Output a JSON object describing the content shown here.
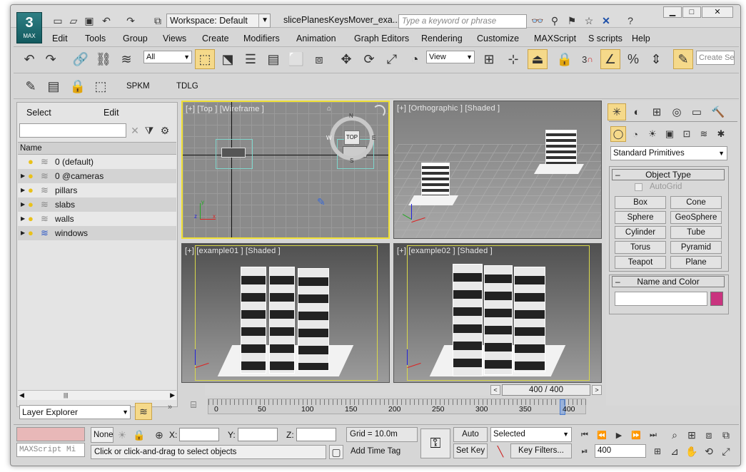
{
  "title_bar": {
    "workspace": "Workspace: Default",
    "file": "slicePlanesKeysMover_exa...",
    "search_placeholder": "Type a keyword or phrase",
    "app_logo": "MAX"
  },
  "menu": [
    "Edit",
    "Tools",
    "Group",
    "Views",
    "Create",
    "Modifiers",
    "Animation",
    "Graph Editors",
    "Rendering",
    "Customize",
    "MAXScript",
    "S scripts",
    "Help"
  ],
  "toolbar": {
    "selection_filter": "All",
    "ref_coord": "View",
    "create_sel": "Create Se",
    "snap_label": "3"
  },
  "custom_toolbar": {
    "spkm": "SPKM",
    "tdlg": "TDLG"
  },
  "layer_explorer": {
    "select_label": "Select",
    "edit_label": "Edit",
    "column_header": "Name",
    "layers": [
      "0 (default)",
      "0 @cameras",
      "pillars",
      "slabs",
      "walls",
      "windows"
    ],
    "footer_label": "Layer Explorer"
  },
  "viewports": {
    "top": "[+] [Top ] [Wireframe ]",
    "ortho": "[+] [Orthographic ] [Shaded ]",
    "ex1": "[+] [example01 ] [Shaded ]",
    "ex2": "[+] [example02 ] [Shaded ]",
    "viewcube_top": "TOP",
    "compass_n": "N",
    "compass_w": "W",
    "compass_e": "E",
    "compass_s": "S"
  },
  "command_panel": {
    "dropdown": "Standard Primitives",
    "object_type": "Object Type",
    "autogrid": "AutoGrid",
    "buttons": [
      "Box",
      "Cone",
      "Sphere",
      "GeoSphere",
      "Cylinder",
      "Tube",
      "Torus",
      "Pyramid",
      "Teapot",
      "Plane"
    ],
    "name_and_color": "Name and Color",
    "color": "#c9347f"
  },
  "timeline": {
    "slider": "400 / 400",
    "ticks": [
      "0",
      "50",
      "100",
      "150",
      "200",
      "250",
      "300",
      "350",
      "400"
    ]
  },
  "status": {
    "listener_placeholder": "MAXScript Mi",
    "none_label": "None",
    "x_label": "X:",
    "y_label": "Y:",
    "z_label": "Z:",
    "grid": "Grid = 10.0m",
    "auto_key": "Auto Key",
    "set_key": "Set Key",
    "selected": "Selected",
    "key_filters": "Key Filters...",
    "frame": "400",
    "prompt": "Click or click-and-drag to select objects",
    "add_time_tag": "Add Time Tag"
  }
}
